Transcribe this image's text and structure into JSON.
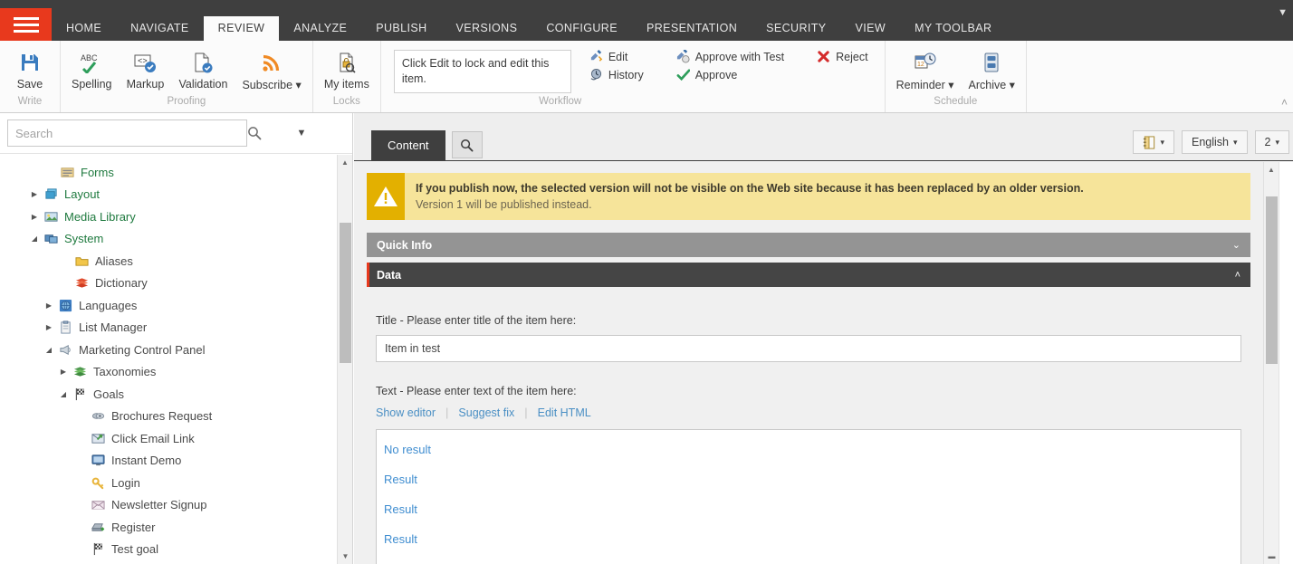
{
  "topbar": {
    "menu_icon": "hamburger-icon",
    "tabs": [
      {
        "label": "HOME",
        "active": false
      },
      {
        "label": "NAVIGATE",
        "active": false
      },
      {
        "label": "REVIEW",
        "active": true
      },
      {
        "label": "ANALYZE",
        "active": false
      },
      {
        "label": "PUBLISH",
        "active": false
      },
      {
        "label": "VERSIONS",
        "active": false
      },
      {
        "label": "CONFIGURE",
        "active": false
      },
      {
        "label": "PRESENTATION",
        "active": false
      },
      {
        "label": "SECURITY",
        "active": false
      },
      {
        "label": "VIEW",
        "active": false
      },
      {
        "label": "MY TOOLBAR",
        "active": false
      }
    ],
    "caret": "▼",
    "bg_color": "#3f3f3f",
    "accent_color": "#e8391d"
  },
  "ribbon": {
    "groups": [
      {
        "label": "Write",
        "buttons": [
          {
            "caption": "Save",
            "icon": "save-floppy-icon"
          }
        ]
      },
      {
        "label": "Proofing",
        "buttons": [
          {
            "caption": "Spelling",
            "icon": "spellcheck-abc-icon"
          },
          {
            "caption": "Markup",
            "icon": "markup-tag-icon"
          },
          {
            "caption": "Validation",
            "icon": "validation-page-check-icon"
          },
          {
            "caption": "Subscribe ▾",
            "icon": "rss-subscribe-icon"
          }
        ]
      },
      {
        "label": "Locks",
        "buttons": [
          {
            "caption": "My items",
            "icon": "my-items-lock-icon"
          }
        ]
      }
    ],
    "workflow": {
      "label": "Workflow",
      "lock_message": "Click Edit to lock and edit this item.",
      "commands": [
        {
          "caption": "Edit",
          "icon": "edit-pencil-icon"
        },
        {
          "caption": "History",
          "icon": "history-clock-icon"
        },
        {
          "caption": "Approve with Test",
          "icon": "approve-with-test-icon"
        },
        {
          "caption": "Approve",
          "icon": "approve-check-icon"
        },
        {
          "caption": "Reject",
          "icon": "reject-cross-icon"
        }
      ]
    },
    "schedule": {
      "label": "Schedule",
      "buttons": [
        {
          "caption": "Reminder ▾",
          "icon": "reminder-calendar-clock-icon"
        },
        {
          "caption": "Archive ▾",
          "icon": "archive-drawer-icon"
        }
      ]
    },
    "collapse_chevron": "˄"
  },
  "sidebar": {
    "search": {
      "placeholder": "Search",
      "value": "",
      "icon": "search-magnifier-icon",
      "caret": "▼"
    },
    "tree": [
      {
        "label": "Forms",
        "depth": 3,
        "expander": "",
        "icon": "forms-icon",
        "color": "green"
      },
      {
        "label": "Layout",
        "depth": 2,
        "expander": "▶",
        "icon": "layout-icon",
        "color": "green"
      },
      {
        "label": "Media Library",
        "depth": 2,
        "expander": "▶",
        "icon": "media-library-icon",
        "color": "green"
      },
      {
        "label": "System",
        "depth": 2,
        "expander": "◢",
        "icon": "system-icon",
        "color": "green"
      },
      {
        "label": "Aliases",
        "depth": 3,
        "expander": "",
        "icon": "aliases-folder-icon",
        "color": "gray"
      },
      {
        "label": "Dictionary",
        "depth": 3,
        "expander": "",
        "icon": "dictionary-books-icon",
        "color": "gray"
      },
      {
        "label": "Languages",
        "depth": 3,
        "expander": "▶",
        "icon": "languages-globe-icon",
        "color": "gray"
      },
      {
        "label": "List Manager",
        "depth": 3,
        "expander": "▶",
        "icon": "list-manager-clipboard-icon",
        "color": "gray"
      },
      {
        "label": "Marketing Control Panel",
        "depth": 3,
        "expander": "◢",
        "icon": "marketing-control-panel-icon",
        "color": "gray"
      },
      {
        "label": "Taxonomies",
        "depth": 4,
        "expander": "▶",
        "icon": "taxonomies-books-icon",
        "color": "gray"
      },
      {
        "label": "Goals",
        "depth": 4,
        "expander": "◢",
        "icon": "goals-flag-icon",
        "color": "gray"
      },
      {
        "label": "Brochures Request",
        "depth": 5,
        "expander": "",
        "icon": "brochures-request-icon",
        "color": "gray"
      },
      {
        "label": "Click Email Link",
        "depth": 5,
        "expander": "",
        "icon": "click-email-link-icon",
        "color": "gray"
      },
      {
        "label": "Instant Demo",
        "depth": 5,
        "expander": "",
        "icon": "instant-demo-monitor-icon",
        "color": "gray"
      },
      {
        "label": "Login",
        "depth": 5,
        "expander": "",
        "icon": "login-key-icon",
        "color": "gray"
      },
      {
        "label": "Newsletter Signup",
        "depth": 5,
        "expander": "",
        "icon": "newsletter-signup-envelope-icon",
        "color": "gray"
      },
      {
        "label": "Register",
        "depth": 5,
        "expander": "",
        "icon": "register-icon",
        "color": "gray"
      },
      {
        "label": "Test goal",
        "depth": 5,
        "expander": "",
        "icon": "test-goal-flag-icon",
        "color": "gray"
      }
    ],
    "scrollbar": {
      "up_arrow": "▲",
      "down_arrow": "▼"
    }
  },
  "content": {
    "tabs": [
      {
        "label": "Content",
        "active": true
      }
    ],
    "search_tab_icon": "search-magnifier-icon",
    "toolbar_right": [
      {
        "name": "notebook-dropdown",
        "label": "",
        "icon": "notebook-icon",
        "caret": "▾"
      },
      {
        "name": "language-dropdown",
        "label": "English",
        "caret": "▾"
      },
      {
        "name": "version-dropdown",
        "label": "2",
        "caret": "▾"
      }
    ],
    "warning": {
      "icon": "warning-triangle-icon",
      "line1": "If you publish now, the selected version will not be visible on the Web site because it has been replaced by an older version.",
      "line2": "Version 1 will be published instead.",
      "bg_color": "#f6e49a",
      "icon_bg_color": "#e3b000"
    },
    "sections": [
      {
        "title": "Quick Info",
        "collapsed": true,
        "chevron": "⌄",
        "style": "gray"
      },
      {
        "title": "Data",
        "collapsed": false,
        "chevron": "˄",
        "style": "dark"
      }
    ],
    "fields": {
      "title": {
        "label": "Title - Please enter title of the item here:",
        "value": "Item in test",
        "placeholder": ""
      },
      "text": {
        "label": "Text - Please enter text of the item here:",
        "links": [
          "Show editor",
          "Suggest fix",
          "Edit HTML"
        ],
        "lines": [
          "No result",
          "Result",
          "Result",
          "Result"
        ]
      }
    },
    "scrollbar": {
      "up_arrow": "▲",
      "down_arrow": "▬"
    }
  }
}
